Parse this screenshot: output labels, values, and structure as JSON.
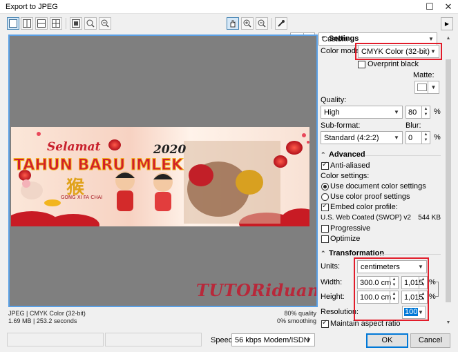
{
  "window": {
    "title": "Export to JPEG"
  },
  "toolbar": {
    "preset": "Custom"
  },
  "preview": {
    "watermark": "TUTORiduan"
  },
  "preview_info": {
    "format_line": "JPEG  |  CMYK Color (32-bit)",
    "size_line": "1.69 MB  |  253.2 seconds",
    "quality_line": "80% quality",
    "smoothing_line": "0% smoothing"
  },
  "settings": {
    "section": "Settings",
    "color_mode_label": "Color mode:",
    "color_mode_value": "CMYK Color (32-bit)",
    "overprint_black": "Overprint black",
    "matte_label": "Matte:",
    "quality_label": "Quality:",
    "quality_value": "High",
    "quality_number": "80",
    "percent": "%",
    "subformat_label": "Sub-format:",
    "subformat_value": "Standard (4:2:2)",
    "blur_label": "Blur:",
    "blur_value": "0"
  },
  "advanced": {
    "section": "Advanced",
    "anti_aliased": "Anti-aliased",
    "color_settings_label": "Color settings:",
    "use_document": "Use document color settings",
    "use_proof": "Use color proof settings",
    "embed_profile": "Embed color profile:",
    "profile_name": "U.S. Web Coated (SWOP) v2",
    "profile_size": "544 KB",
    "progressive": "Progressive",
    "optimize": "Optimize"
  },
  "transformation": {
    "section": "Transformation",
    "units_label": "Units:",
    "units_value": "centimeters",
    "width_label": "Width:",
    "width_value": "300.0 cm",
    "width_pct": "1,015",
    "height_label": "Height:",
    "height_value": "100.0 cm",
    "height_pct": "1,015",
    "percent": "%",
    "resolution_label": "Resolution:",
    "resolution_value": "100",
    "maintain_aspect": "Maintain aspect ratio"
  },
  "footer": {
    "speed_label": "Speed:",
    "speed_value": "56 kbps Modem/ISDN",
    "ok": "OK",
    "cancel": "Cancel"
  },
  "banner_text": {
    "selamat": "Selamat",
    "year": "2020",
    "headline": "TAHUN BARU IMLEK",
    "subline": "GONG XI FA CHAI"
  },
  "colors": {
    "highlight": "#e21c2a",
    "selection": "#0078d7",
    "preview_bg": "#7f7f7f"
  }
}
